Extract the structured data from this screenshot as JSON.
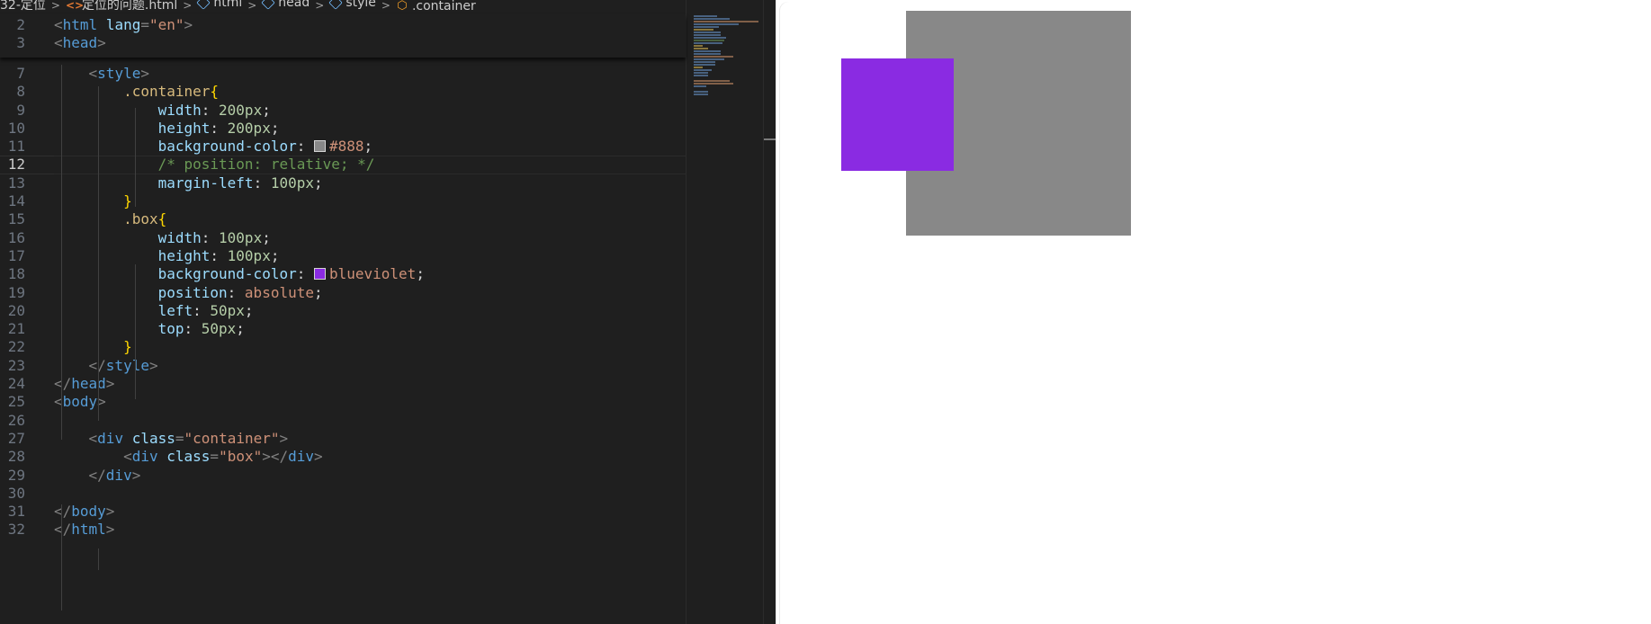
{
  "breadcrumb": {
    "folder": "32-定位",
    "file": "定位的问题.html",
    "items": [
      "html",
      "head",
      "style",
      ".container"
    ]
  },
  "code_lines": [
    {
      "n": "2",
      "html": "<span class='br'>&lt;</span><span class='tag'>html</span> <span class='attr'>lang</span><span class='br'>=</span><span class='str'>\"en\"</span><span class='br'>&gt;</span>"
    },
    {
      "n": "3",
      "html": "<span class='br'>&lt;</span><span class='tag'>head</span><span class='br'>&gt;</span>"
    },
    {
      "n": "7",
      "html": "    <span class='br'>&lt;</span><span class='tag'>style</span><span class='br'>&gt;</span>"
    },
    {
      "n": "8",
      "html": "        <span class='sel'>.container</span><span class='cb'>{</span>"
    },
    {
      "n": "9",
      "html": "            <span class='prop'>width</span>: <span class='num'>200px</span>;"
    },
    {
      "n": "10",
      "html": "            <span class='prop'>height</span>: <span class='num'>200px</span>;"
    },
    {
      "n": "11",
      "html": "            <span class='prop'>background-color</span>: <span class='swatch' style='background:#888'></span><span class='kw'>#888</span>;"
    },
    {
      "n": "12",
      "html": "            <span class='cmt'>/* position: relative; */</span>",
      "current": true
    },
    {
      "n": "13",
      "html": "            <span class='prop'>margin-left</span>: <span class='num'>100px</span>;"
    },
    {
      "n": "14",
      "html": "        <span class='cb'>}</span>"
    },
    {
      "n": "15",
      "html": "        <span class='sel'>.box</span><span class='cb'>{</span>"
    },
    {
      "n": "16",
      "html": "            <span class='prop'>width</span>: <span class='num'>100px</span>;"
    },
    {
      "n": "17",
      "html": "            <span class='prop'>height</span>: <span class='num'>100px</span>;"
    },
    {
      "n": "18",
      "html": "            <span class='prop'>background-color</span>: <span class='swatch' style='background:#8a2be2'></span><span class='kw'>blueviolet</span>;"
    },
    {
      "n": "19",
      "html": "            <span class='prop'>position</span>: <span class='kw'>absolute</span>;"
    },
    {
      "n": "20",
      "html": "            <span class='prop'>left</span>: <span class='num'>50px</span>;"
    },
    {
      "n": "21",
      "html": "            <span class='prop'>top</span>: <span class='num'>50px</span>;"
    },
    {
      "n": "22",
      "html": "        <span class='cb'>}</span>"
    },
    {
      "n": "23",
      "html": "    <span class='br'>&lt;/</span><span class='tag'>style</span><span class='br'>&gt;</span>"
    },
    {
      "n": "24",
      "html": "<span class='br'>&lt;/</span><span class='tag'>head</span><span class='br'>&gt;</span>"
    },
    {
      "n": "25",
      "html": "<span class='br'>&lt;</span><span class='tag'>body</span><span class='br'>&gt;</span>"
    },
    {
      "n": "26",
      "html": ""
    },
    {
      "n": "27",
      "html": "    <span class='br'>&lt;</span><span class='tag'>div</span> <span class='attr'>class</span><span class='br'>=</span><span class='str'>\"container\"</span><span class='br'>&gt;</span>"
    },
    {
      "n": "28",
      "html": "        <span class='br'>&lt;</span><span class='tag'>div</span> <span class='attr'>class</span><span class='br'>=</span><span class='str'>\"box\"</span><span class='br'>&gt;&lt;/</span><span class='tag'>div</span><span class='br'>&gt;</span>"
    },
    {
      "n": "29",
      "html": "    <span class='br'>&lt;/</span><span class='tag'>div</span><span class='br'>&gt;</span>"
    },
    {
      "n": "30",
      "html": ""
    },
    {
      "n": "31",
      "html": "<span class='br'>&lt;/</span><span class='tag'>body</span><span class='br'>&gt;</span>"
    },
    {
      "n": "32",
      "html": "<span class='br'>&lt;/</span><span class='tag'>html</span><span class='br'>&gt;</span>"
    }
  ],
  "preview": {
    "container_color": "#888888",
    "box_color": "#8a2be2"
  },
  "icons": {
    "file": "html-file-icon",
    "element": "element-cube-icon",
    "selector": "css-selector-icon"
  }
}
